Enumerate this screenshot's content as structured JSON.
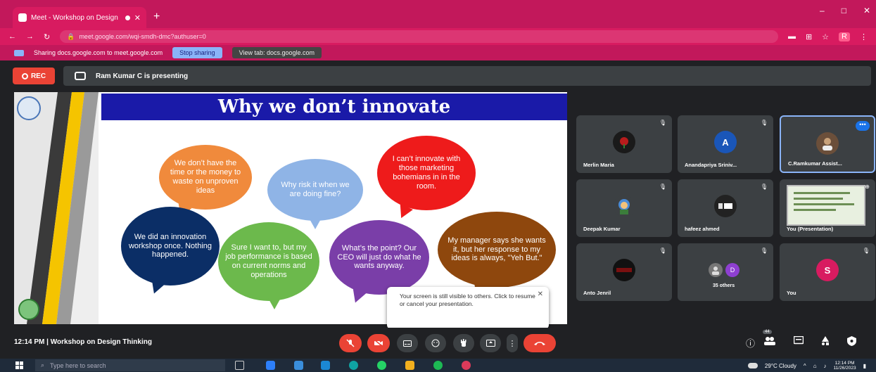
{
  "browser": {
    "tab_title": "Meet - Workshop on Design",
    "tab_close": "✕",
    "new_tab": "+",
    "window_controls": [
      "–",
      "□",
      "✕"
    ],
    "nav": {
      "back": "←",
      "forward": "→",
      "reload": "↻"
    },
    "url": "meet.google.com/wqi-smdh-dmc?authuser=0",
    "addr_icons": [
      "▬",
      "⊞",
      "☆"
    ],
    "ext_badge": "R",
    "menu": "⋮"
  },
  "sharebar": {
    "message": "Sharing docs.google.com to meet.google.com",
    "stop_label": "Stop sharing",
    "view_label": "View tab: docs.google.com"
  },
  "meet": {
    "rec_label": "REC",
    "presenting_text": "Ram Kumar C is presenting",
    "bottom_info": "12:14 PM  |  Workshop on Design Thinking"
  },
  "slide": {
    "title": "Why we don’t innovate",
    "bubbles": {
      "orange": "We don’t have the time or the money to waste on unproven ideas",
      "blue": "Why risk it when we are doing fine?",
      "red": "I can’t innovate with those marketing bohemians in in the room.",
      "navy": "We did an innovation workshop once. Nothing happened.",
      "green": "Sure I want to, but my job performance is based on current norms and operations",
      "purple": "What’s the point? Our CEO will just do what he wants anyway.",
      "brown": "My manager says she wants it, but her response to my ideas is always, \"Yeh But.\""
    }
  },
  "toast": {
    "text": "Your screen is still visible to others. Click to resume or cancel your presentation.",
    "close": "✕"
  },
  "participants": [
    {
      "name": "Merlin Maria",
      "avatar": "",
      "color": "#b71c1c"
    },
    {
      "name": "Anandapriya Sriniv...",
      "avatar": "A",
      "color": "#1a56b8"
    },
    {
      "name": "C.Ramkumar Assist...",
      "avatar": "",
      "color": "#6b4f3a"
    },
    {
      "name": "Deepak Kumar",
      "avatar": "",
      "color": "#4a8bd6"
    },
    {
      "name": "hafeez ahmed",
      "avatar": "",
      "color": "#555555"
    },
    {
      "name": "You (Presentation)",
      "avatar": "",
      "color": "#e8f0e0"
    },
    {
      "name": "Anto Jenril",
      "avatar": "",
      "color": "#7a1010"
    },
    {
      "name": "35 others",
      "avatar": "D",
      "color": "#8e3fd1"
    },
    {
      "name": "You",
      "avatar": "S",
      "color": "#d81b60"
    }
  ],
  "more_label": "•••",
  "mic_icon": "🎙",
  "controls": {
    "people_count": "44"
  },
  "taskbar": {
    "search_placeholder": "Type here to search",
    "weather": "29°C  Cloudy",
    "time": "12:14 PM",
    "date": "11/26/2023",
    "tray_arrow": "^"
  },
  "colors": {
    "browser_accent": "#c2185b",
    "meet_bg": "#202124",
    "tile_bg": "#3c4043",
    "end_call": "#ea4335"
  }
}
